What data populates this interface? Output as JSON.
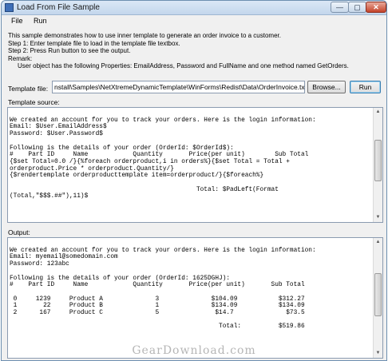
{
  "window": {
    "title": "Load From File Sample",
    "minimize_label": "—",
    "maximize_label": "▢",
    "close_label": "✕"
  },
  "menu": {
    "file": "File",
    "run": "Run"
  },
  "description": [
    "This sample demonstrates how to use inner template to generate an order invoice to a customer.",
    "Step 1: Enter template file to load in the template file textbox.",
    "Step 2: Press Run button to see the output.",
    "Remark:",
    "User object has the following Properties: EmailAddress, Password and FullName and one method named GetOrders."
  ],
  "template_file": {
    "label": "Template file:",
    "value": "nstall\\Samples\\NetXtremeDynamicTemplate\\WinForms\\Redist\\Data\\OrderInvoice.txt",
    "browse_label": "Browse...",
    "run_label": "Run"
  },
  "template_source": {
    "label": "Template source:",
    "text": "\nWe created an account for you to track your orders. Here is the login information:\nEmail: $User.EmailAddress$\nPassword: $User.Password$\n\nFollowing is the details of your order (OrderId: $OrderId$):\n#    Part ID     Name            Quantity       Price(per unit)        Sub Total\n{$set Total=0.0 /}{%foreach orderproduct,i in orders%}{$set Total = Total +\norderproduct.Price * orderproduct.Quantity/}\n{$rendertemplate orderproducttemplate item=orderproduct/}{$foreach%}\n\n                                                  Total: $PadLeft(Format\n(Total,\"$$$.##\"),11)$"
  },
  "output": {
    "label": "Output:",
    "text": "\nWe created an account for you to track your orders. Here is the login information:\nEmail: myemail@somedomain.com\nPassword: 123abc\n\nFollowing is the details of your order (OrderId: 1625DGHJ):\n#    Part ID     Name            Quantity       Price(per unit)       Sub Total\n\n 0     1239     Product A              3              $104.09           $312.27\n 1       22     Product B              1              $134.09           $134.09\n 2      167     Product C              5               $14.7              $73.5\n\n                                                        Total:          $519.86"
  },
  "watermark": "GearDownload.com"
}
